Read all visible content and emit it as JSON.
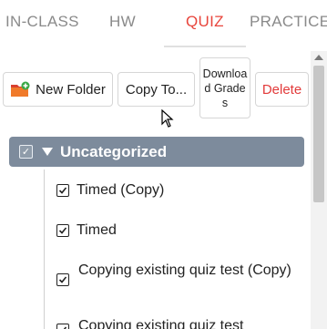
{
  "tabs": [
    {
      "label": "IN-CLASS",
      "active": false
    },
    {
      "label": "HW",
      "active": false
    },
    {
      "label": "QUIZ",
      "active": true
    },
    {
      "label": "PRACTICE",
      "active": false
    }
  ],
  "toolbar": {
    "new_folder": "New Folder",
    "copy_to": "Copy To...",
    "download_grades": "Download Grades",
    "delete": "Delete"
  },
  "category": {
    "label": "Uncategorized",
    "checked": true
  },
  "items": [
    {
      "label": "Timed (Copy)",
      "checked": true
    },
    {
      "label": "Timed",
      "checked": true
    },
    {
      "label": "Copying existing quiz test (Copy)",
      "checked": true
    },
    {
      "label": "Copying existing quiz test",
      "checked": true
    }
  ],
  "colors": {
    "accent": "#e8453c",
    "category_bg": "#7d8b9c",
    "delete": "#e23a3a"
  },
  "icons": {
    "new_folder": "folder-add-icon",
    "cursor": "mouse-pointer-icon",
    "collapse": "triangle-down-icon"
  }
}
